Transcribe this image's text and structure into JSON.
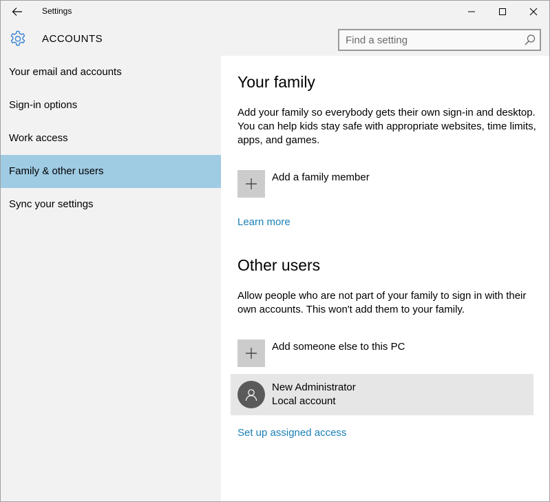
{
  "window": {
    "title": "Settings",
    "back_icon": "back-arrow-icon",
    "minimize_icon": "minimize-icon",
    "maximize_icon": "maximize-icon",
    "close_icon": "close-icon"
  },
  "header": {
    "icon": "gear-icon",
    "title": "ACCOUNTS",
    "search": {
      "placeholder": "Find a setting",
      "value": "",
      "icon": "search-icon"
    }
  },
  "sidebar": {
    "items": [
      {
        "label": "Your email and accounts",
        "selected": false
      },
      {
        "label": "Sign-in options",
        "selected": false
      },
      {
        "label": "Work access",
        "selected": false
      },
      {
        "label": "Family & other users",
        "selected": true
      },
      {
        "label": "Sync your settings",
        "selected": false
      }
    ]
  },
  "content": {
    "family": {
      "heading": "Your family",
      "description": "Add your family so everybody gets their own sign-in and desktop. You can help kids stay safe with appropriate websites, time limits, apps, and games.",
      "add_label": "Add a family member",
      "learn_more": "Learn more"
    },
    "other_users": {
      "heading": "Other users",
      "description": "Allow people who are not part of your family to sign in with their own accounts. This won't add them to your family.",
      "add_label": "Add someone else to this PC",
      "users": [
        {
          "name": "New Administrator",
          "type": "Local account",
          "icon": "user-icon"
        }
      ],
      "assigned_access": "Set up assigned access"
    }
  },
  "colors": {
    "chrome_bg": "#f2f2f2",
    "selected_nav": "#9fcbe3",
    "link": "#1a7fb5",
    "tile": "#cccccc",
    "user_row": "#e6e6e6",
    "avatar": "#5a5a5a",
    "accent_gear": "#2b7cd3"
  }
}
